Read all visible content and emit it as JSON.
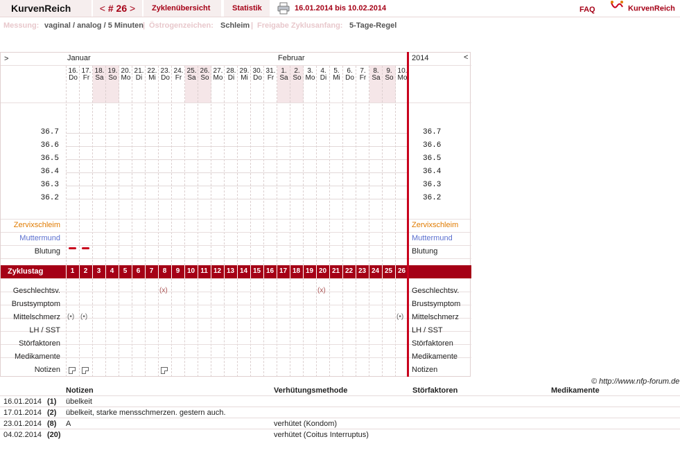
{
  "topbar": {
    "app_title": "KurvenReich",
    "cycle_prev": "<",
    "cycle_label": "# 26",
    "cycle_next": ">",
    "tab_overview": "Zyklenübersicht",
    "tab_stats": "Statistik",
    "date_range": "16.01.2014 bis 10.02.2014",
    "faq": "FAQ",
    "logo_text": "KurvenReich",
    "icons": {
      "print": "printer-icon",
      "logo": "kurvenreich-logo-icon"
    }
  },
  "settings": {
    "measure_label": "Messung:",
    "measure_value": "vaginal / analog / 5 Minuten",
    "estrogen_label": "Östrogenzeichen:",
    "estrogen_value": "Schleim",
    "release_label": "Freigabe Zyklusanfang:",
    "release_value": "5-Tage-Regel"
  },
  "chart": {
    "nav_left": ">",
    "nav_right": "<",
    "year": "2014",
    "months": [
      {
        "label": "Januar",
        "col": 0
      },
      {
        "label": "Februar",
        "col": 16
      }
    ],
    "days": [
      {
        "d": "16.",
        "w": "Do",
        "we": false
      },
      {
        "d": "17.",
        "w": "Fr",
        "we": false
      },
      {
        "d": "18.",
        "w": "Sa",
        "we": true
      },
      {
        "d": "19.",
        "w": "So",
        "we": true
      },
      {
        "d": "20.",
        "w": "Mo",
        "we": false
      },
      {
        "d": "21.",
        "w": "Di",
        "we": false
      },
      {
        "d": "22.",
        "w": "Mi",
        "we": false
      },
      {
        "d": "23.",
        "w": "Do",
        "we": false
      },
      {
        "d": "24.",
        "w": "Fr",
        "we": false
      },
      {
        "d": "25.",
        "w": "Sa",
        "we": true
      },
      {
        "d": "26.",
        "w": "So",
        "we": true
      },
      {
        "d": "27.",
        "w": "Mo",
        "we": false
      },
      {
        "d": "28.",
        "w": "Di",
        "we": false
      },
      {
        "d": "29.",
        "w": "Mi",
        "we": false
      },
      {
        "d": "30.",
        "w": "Do",
        "we": false
      },
      {
        "d": "31.",
        "w": "Fr",
        "we": false
      },
      {
        "d": "1.",
        "w": "Sa",
        "we": true
      },
      {
        "d": "2.",
        "w": "So",
        "we": true
      },
      {
        "d": "3.",
        "w": "Mo",
        "we": false
      },
      {
        "d": "4.",
        "w": "Di",
        "we": false
      },
      {
        "d": "5.",
        "w": "Mi",
        "we": false
      },
      {
        "d": "6.",
        "w": "Do",
        "we": false
      },
      {
        "d": "7.",
        "w": "Fr",
        "we": false
      },
      {
        "d": "8.",
        "w": "Sa",
        "we": true
      },
      {
        "d": "9.",
        "w": "So",
        "we": true
      },
      {
        "d": "10.",
        "w": "Mo",
        "we": false
      }
    ],
    "temps": [
      "36.7",
      "36.6",
      "36.5",
      "36.4",
      "36.3",
      "36.2"
    ],
    "rows_top": [
      {
        "label": "Zervixschleim",
        "color": "orange"
      },
      {
        "label": "Muttermund",
        "color": "blue"
      },
      {
        "label": "Blutung",
        "color": "normal"
      }
    ],
    "bleeding_days": [
      1,
      2
    ],
    "zyklustag_label": "Zyklustag",
    "cycle_days": [
      "1",
      "2",
      "3",
      "4",
      "5",
      "6",
      "7",
      "8",
      "9",
      "10",
      "11",
      "12",
      "13",
      "14",
      "15",
      "16",
      "17",
      "18",
      "19",
      "20",
      "21",
      "22",
      "23",
      "24",
      "25",
      "26"
    ],
    "rows_bottom": [
      {
        "label": "Geschlechtsv."
      },
      {
        "label": "Brustsymptom"
      },
      {
        "label": "Mittelschmerz"
      },
      {
        "label": "LH / SST"
      },
      {
        "label": "Störfaktoren"
      },
      {
        "label": "Medikamente"
      },
      {
        "label": "Notizen"
      }
    ],
    "intercourse_days": [
      8,
      20
    ],
    "intercourse_mark": "(x)",
    "mittelschmerz_days": [
      1,
      2,
      26
    ],
    "mittelschmerz_mark": "(•)",
    "notes_days": [
      1,
      2,
      8
    ]
  },
  "copyright": "© http://www.nfp-forum.de",
  "notes_table": {
    "headers": {
      "notes": "Notizen",
      "contraception": "Verhütungsmethode",
      "disturbances": "Störfaktoren",
      "medication": "Medikamente"
    },
    "rows": [
      {
        "date": "16.01.2014",
        "day": "(1)",
        "note": "übelkeit",
        "contra": ""
      },
      {
        "date": "17.01.2014",
        "day": "(2)",
        "note": "übelkeit, starke mensschmerzen. gestern auch.",
        "contra": ""
      },
      {
        "date": "23.01.2014",
        "day": "(8)",
        "note": "A",
        "contra": "verhütet (Kondom)"
      },
      {
        "date": "04.02.2014",
        "day": "(20)",
        "note": "",
        "contra": "verhütet (Coitus Interruptus)"
      }
    ]
  }
}
